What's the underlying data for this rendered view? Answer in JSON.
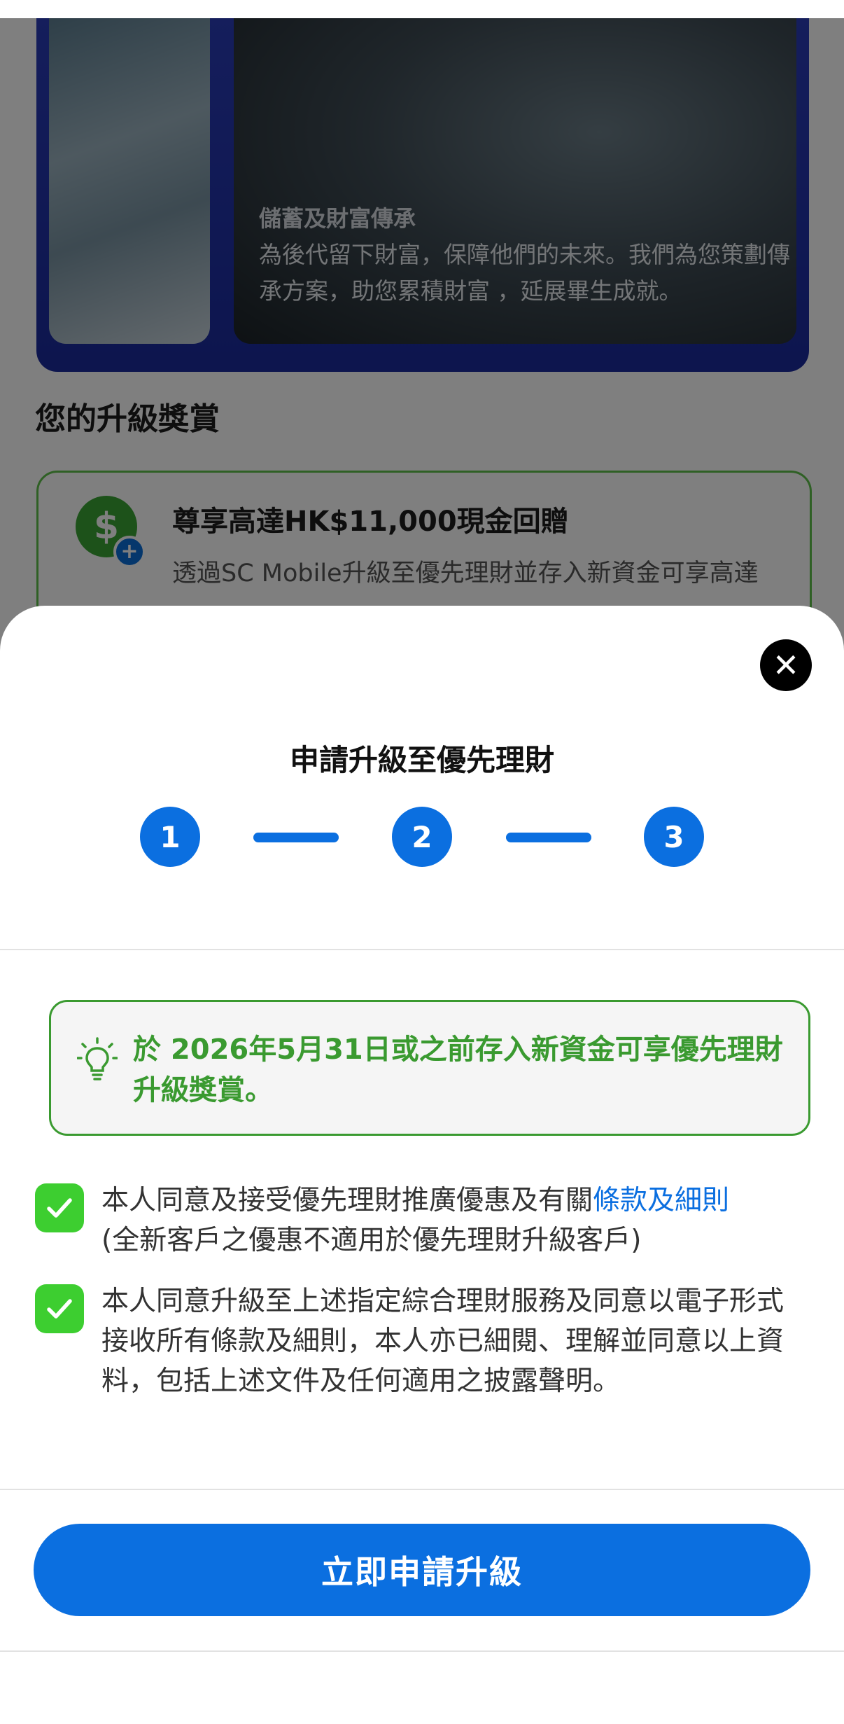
{
  "background": {
    "promo": {
      "title": "儲蓄及財富傳承",
      "description": "為後代留下財富，保障他們的未來。我們為您策劃傳承方案，助您累積財富 ，延展畢生成就。"
    },
    "section_title": "您的升級獎賞",
    "reward": {
      "icon_symbol": "$",
      "badge_symbol": "+",
      "title": "尊享高達HK$11,000現金回贈",
      "description": "透過SC Mobile升級至優先理財並存入新資金可享高達"
    }
  },
  "sheet": {
    "close_symbol": "✕",
    "title": "申請升級至優先理財",
    "steps": [
      "1",
      "2",
      "3"
    ],
    "notice": "於 2026年5月31日或之前存入新資金可享優先理財升級獎賞。",
    "consents": [
      {
        "checked": true,
        "text_before_link": "本人同意及接受優先理財推廣優惠及有關",
        "link_text": "條款及細則",
        "text_after_link": "(全新客戶之優惠不適用於優先理財升級客戶)"
      },
      {
        "checked": true,
        "text": "本人同意升級至上述指定綜合理財服務及同意以電子形式接收所有條款及細則，本人亦已細閱、理解並同意以上資料，包括上述文件及任何適用之披露聲明。"
      }
    ],
    "apply_button": "立即申請升級"
  },
  "colors": {
    "primary_blue": "#0b6fe0",
    "notice_green": "#3a9a30",
    "checkbox_green": "#3dce30",
    "overlay": "rgba(0,0,0,0.5)"
  }
}
